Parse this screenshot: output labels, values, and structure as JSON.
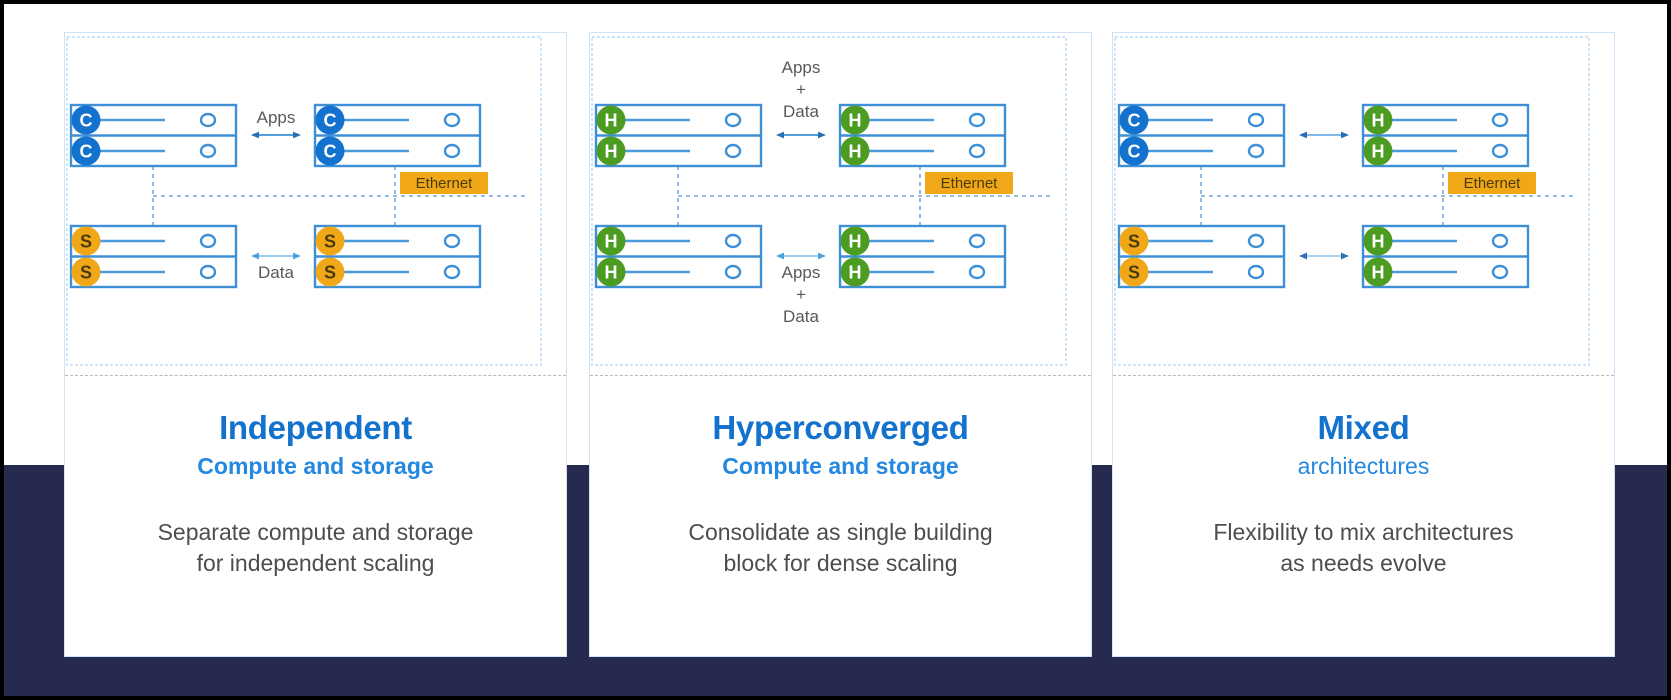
{
  "slide": {
    "background_color": "#ffffff",
    "band_color": "#252a4e",
    "accent_blue": "#1272cd",
    "light_blue": "#2488e0",
    "compute_color": "#1272cd",
    "storage_color": "#f0a818",
    "hci_color": "#4c9c22",
    "ethernet_color": "#f0a818",
    "rack_outline": "#3d8fd6",
    "body_text_color": "#4d4d4d"
  },
  "cards": [
    {
      "id": "independent",
      "title": "Independent",
      "subtitle": "Compute and storage",
      "subtitle_weight": "bold",
      "body_line1": "Separate compute and storage",
      "body_line2": "for independent scaling",
      "diagram": {
        "top_left_badges": [
          "C",
          "C"
        ],
        "top_right_badges": [
          "C",
          "C"
        ],
        "bottom_left_badges": [
          "S",
          "S"
        ],
        "bottom_right_badges": [
          "S",
          "S"
        ],
        "top_arrow_label": "Apps",
        "top_arrow_label_position": "above",
        "bottom_arrow_label": "Data",
        "bottom_arrow_label_position": "below",
        "ethernet_label": "Ethernet"
      }
    },
    {
      "id": "hyperconverged",
      "title": "Hyperconverged",
      "subtitle": "Compute and storage",
      "subtitle_weight": "bold",
      "body_line1": "Consolidate as single building",
      "body_line2": "block for dense scaling",
      "diagram": {
        "top_left_badges": [
          "H",
          "H"
        ],
        "top_right_badges": [
          "H",
          "H"
        ],
        "bottom_left_badges": [
          "H",
          "H"
        ],
        "bottom_right_badges": [
          "H",
          "H"
        ],
        "top_arrow_label": "Apps\n+\nData",
        "top_arrow_label_position": "above",
        "bottom_arrow_label": "Apps\n+\nData",
        "bottom_arrow_label_position": "below",
        "ethernet_label": "Ethernet"
      }
    },
    {
      "id": "mixed",
      "title": "Mixed",
      "subtitle": "architectures",
      "subtitle_weight": "normal",
      "body_line1": "Flexibility to mix architectures",
      "body_line2": "as needs evolve",
      "diagram": {
        "top_left_badges": [
          "C",
          "C"
        ],
        "top_right_badges": [
          "H",
          "H"
        ],
        "bottom_left_badges": [
          "S",
          "S"
        ],
        "bottom_right_badges": [
          "H",
          "H"
        ],
        "top_arrow_label": "",
        "top_arrow_label_position": "above",
        "bottom_arrow_label": "",
        "bottom_arrow_label_position": "below",
        "ethernet_label": "Ethernet"
      }
    }
  ],
  "legend": {
    "compute_letter": "C",
    "storage_letter": "S",
    "hci_letter": "H"
  }
}
